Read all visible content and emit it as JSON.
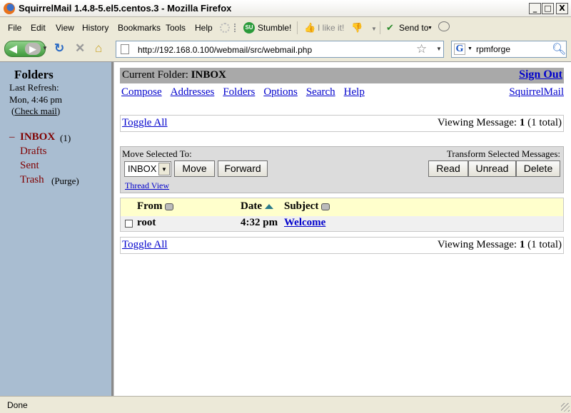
{
  "window": {
    "title": "SquirrelMail 1.4.8-5.el5.centos.3 - Mozilla Firefox",
    "min": "_",
    "max": "□",
    "close": "X"
  },
  "menu": [
    "File",
    "Edit",
    "View",
    "History",
    "Bookmarks",
    "Tools",
    "Help"
  ],
  "toolbar": {
    "stumble": "Stumble!",
    "stumble_icon_text": "SU",
    "like": "I like it!",
    "sendto": "Send to"
  },
  "nav": {
    "url": "http://192.168.0.100/webmail/src/webmail.php",
    "search_engine": "G",
    "search_value": "rpmforge"
  },
  "left": {
    "title": "Folders",
    "last_refresh_label": "Last Refresh:",
    "last_refresh_time": "Mon, 4:46 pm",
    "check_mail": "Check mail",
    "folders": [
      {
        "name": "INBOX",
        "count": "(1)"
      },
      {
        "name": "Drafts"
      },
      {
        "name": "Sent"
      },
      {
        "name": "Trash",
        "extra": "(Purge)"
      }
    ]
  },
  "right": {
    "current_folder_label": "Current Folder:",
    "current_folder": "INBOX",
    "sign_out": "Sign Out",
    "links": [
      "Compose",
      "Addresses",
      "Folders",
      "Options",
      "Search",
      "Help"
    ],
    "squirrelmail": "SquirrelMail",
    "toggle_all": "Toggle All",
    "viewing_prefix": "Viewing Message:",
    "viewing_num": "1",
    "viewing_total": "(1 total)",
    "move_label": "Move Selected To:",
    "transform_label": "Transform Selected Messages:",
    "move_select": "INBOX",
    "buttons": {
      "move": "Move",
      "forward": "Forward",
      "read": "Read",
      "unread": "Unread",
      "delete": "Delete"
    },
    "thread_view": "Thread View",
    "columns": {
      "from": "From",
      "date": "Date",
      "subject": "Subject"
    },
    "messages": [
      {
        "from": "root",
        "date": "4:32 pm",
        "subject": "Welcome"
      }
    ]
  },
  "status": "Done"
}
